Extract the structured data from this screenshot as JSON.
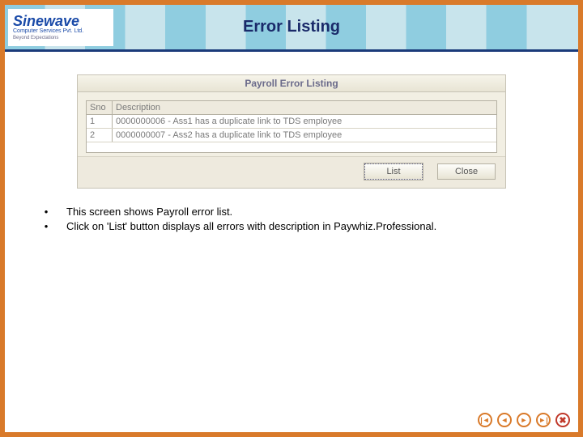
{
  "logo": {
    "brand": "Sinewave",
    "subtitle": "Computer Services Pvt. Ltd.",
    "tagline": "Beyond Expectations"
  },
  "header": {
    "title": "Error Listing"
  },
  "window": {
    "title": "Payroll Error Listing",
    "columns": {
      "sno": "Sno",
      "desc": "Description"
    },
    "rows": [
      {
        "sno": "1",
        "desc": "0000000006 - Ass1 has a duplicate link to TDS employee"
      },
      {
        "sno": "2",
        "desc": "0000000007 - Ass2 has a duplicate link to TDS employee"
      }
    ],
    "buttons": {
      "list": "List",
      "close": "Close"
    }
  },
  "bullets": {
    "b1": "This screen shows Payroll error list.",
    "b2": "Click on 'List' button displays all errors with description in Paywhiz.Professional."
  },
  "nav": {
    "first": "|◄",
    "prev": "◄",
    "next": "►",
    "last": "►|",
    "close": "✖"
  }
}
